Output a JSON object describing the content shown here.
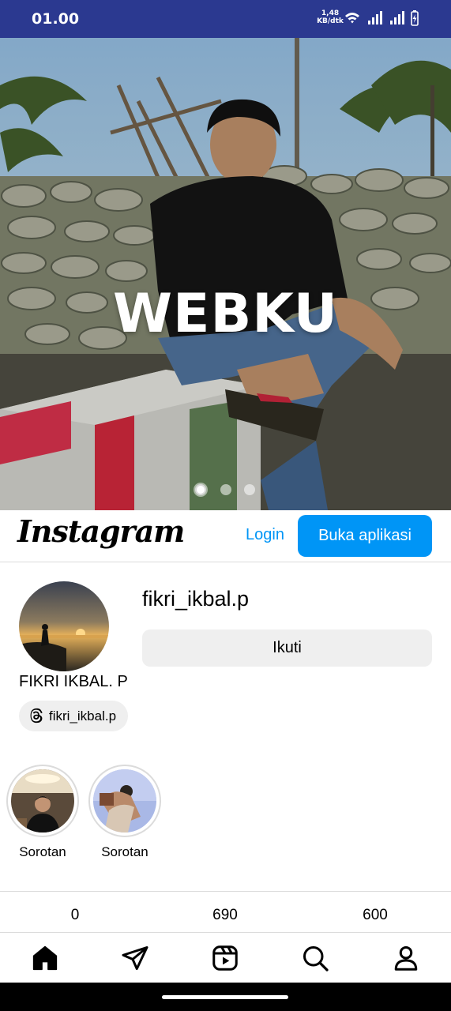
{
  "status_bar": {
    "time": "01.00",
    "speed_value": "1,48",
    "speed_unit": "KB/dtk"
  },
  "hero": {
    "title": "WEBKU",
    "slide_count": 3,
    "active_slide": 1
  },
  "header": {
    "logo": "Instagram",
    "login_label": "Login",
    "open_app_label": "Buka aplikasi"
  },
  "profile": {
    "username": "fikri_ikbal.p",
    "full_name": "FIKRI IKBAL. P",
    "threads_handle": "fikri_ikbal.p",
    "follow_label": "Ikuti"
  },
  "highlights": [
    {
      "label": "Sorotan"
    },
    {
      "label": "Sorotan"
    }
  ],
  "stats": {
    "posts": "0",
    "followers": "690",
    "following": "600"
  },
  "bottom_nav": [
    "home-icon",
    "direct-icon",
    "reels-icon",
    "search-icon",
    "profile-icon"
  ],
  "colors": {
    "status_bar": "#2b3990",
    "accent": "#0095f6"
  }
}
